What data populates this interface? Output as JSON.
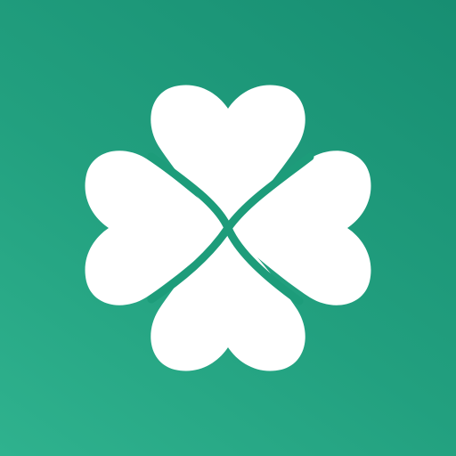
{
  "app_icon": {
    "logo_name": "four-leaf-clover",
    "colors": {
      "background_light": "#2fb28e",
      "background_mid": "#22a07f",
      "background_dark": "#178e72",
      "clover": "#ffffff"
    }
  }
}
